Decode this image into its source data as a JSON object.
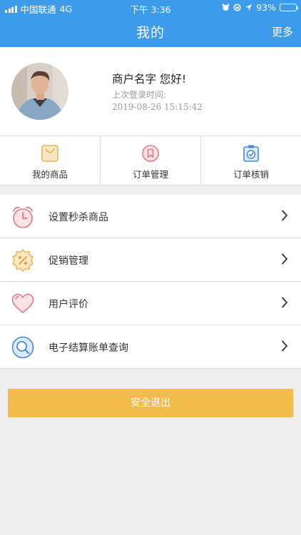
{
  "status_bar": {
    "carrier": "中国联通",
    "network": "4G",
    "time": "下午 3:36",
    "battery": "93%",
    "battery_level": 0.93
  },
  "nav": {
    "title": "我的",
    "more_label": "更多"
  },
  "profile": {
    "greeting": "商户名字 您好!",
    "last_login_label": "上次登录时间:",
    "last_login_time": "2019-08-26 15:15:42"
  },
  "quick_actions": [
    {
      "label": "我的商品",
      "icon": "shopping-bag-icon",
      "color": "#e8b454"
    },
    {
      "label": "订单管理",
      "icon": "bookmark-icon",
      "color": "#e07a82"
    },
    {
      "label": "订单核销",
      "icon": "clipboard-check-icon",
      "color": "#4a8ad4"
    }
  ],
  "menu": [
    {
      "label": "设置秒杀商品",
      "icon": "alarm-clock-icon",
      "color": "#e07a82"
    },
    {
      "label": "促销管理",
      "icon": "discount-badge-icon",
      "color": "#e8b454"
    },
    {
      "label": "用户评价",
      "icon": "heart-icon",
      "color": "#e07a82"
    },
    {
      "label": "电子结算账单查询",
      "icon": "search-icon",
      "color": "#4a8ad4"
    }
  ],
  "logout_label": "安全退出",
  "colors": {
    "header": "#3d9be9",
    "logout": "#f2bc4d",
    "background": "#efefef"
  }
}
